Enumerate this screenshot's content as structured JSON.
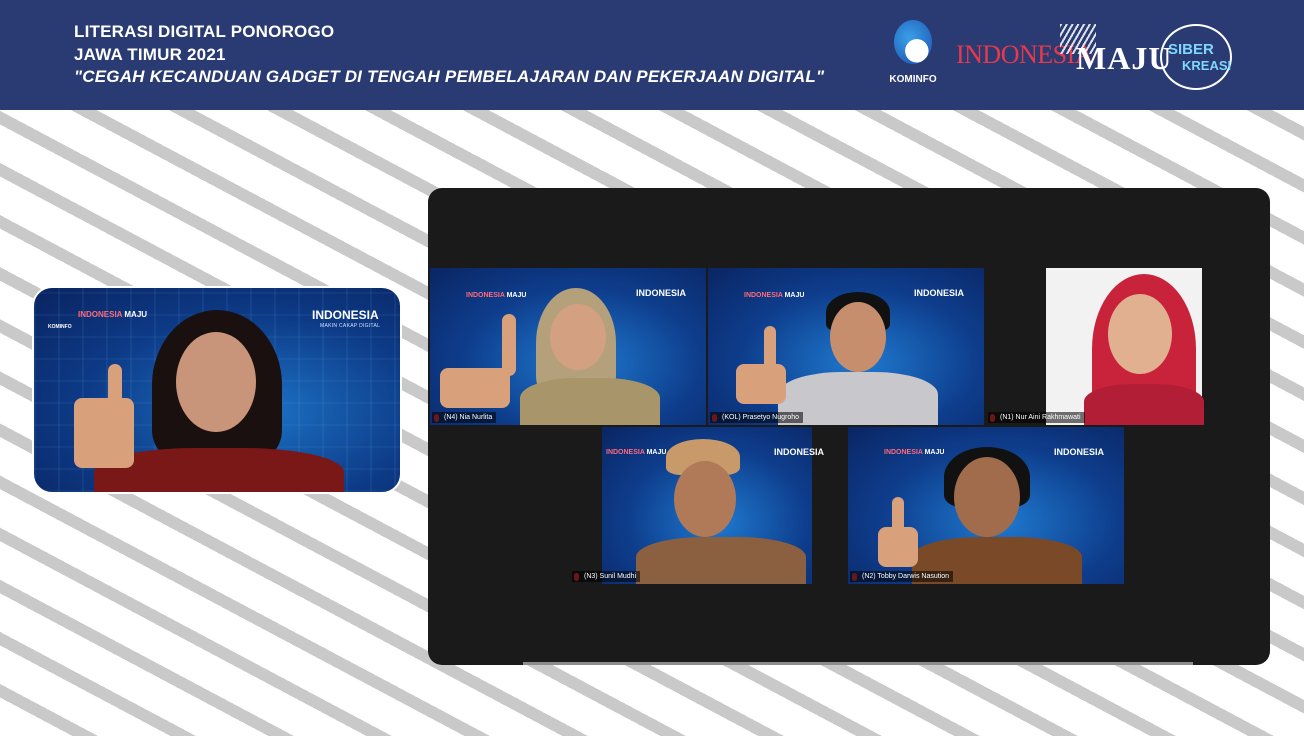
{
  "header": {
    "line1": "LITERASI DIGITAL PONOROGO",
    "line2": "JAWA TIMUR 2021",
    "line3": "\"CEGAH KECANDUAN GADGET DI TENGAH PEMBELAJARAN DAN PEKERJAAN DIGITAL\"",
    "logos": {
      "kominfo": "KOMINFO",
      "indonesia": "INDONESIA",
      "maju": "MAJU",
      "siber": "SIBER",
      "kreasi": "KREASI"
    }
  },
  "speaker": {
    "brand": "INDONESIA",
    "brand_sub": "MAKIN CAKAP DIGITAL",
    "mini_kominfo": "KOMINFO",
    "mini_indonesia": "INDONESIA",
    "mini_maju": "MAJU"
  },
  "participants": [
    {
      "label": "(N4) Nia Nurlita"
    },
    {
      "label": "(KOL) Prasetyo Nugroho"
    },
    {
      "label": "(N1) Nur Aini Rakhmawati"
    },
    {
      "label": "(N3) Sunil Mudhi"
    },
    {
      "label": "(N2) Tobby Darwis Nasution"
    }
  ],
  "tile_brand": "INDONESIA",
  "tile_maju": "MAJU",
  "colors": {
    "header_bg": "#2a3a72",
    "zoom_bg": "#1a1a1a",
    "accent_red": "#e8394a"
  }
}
